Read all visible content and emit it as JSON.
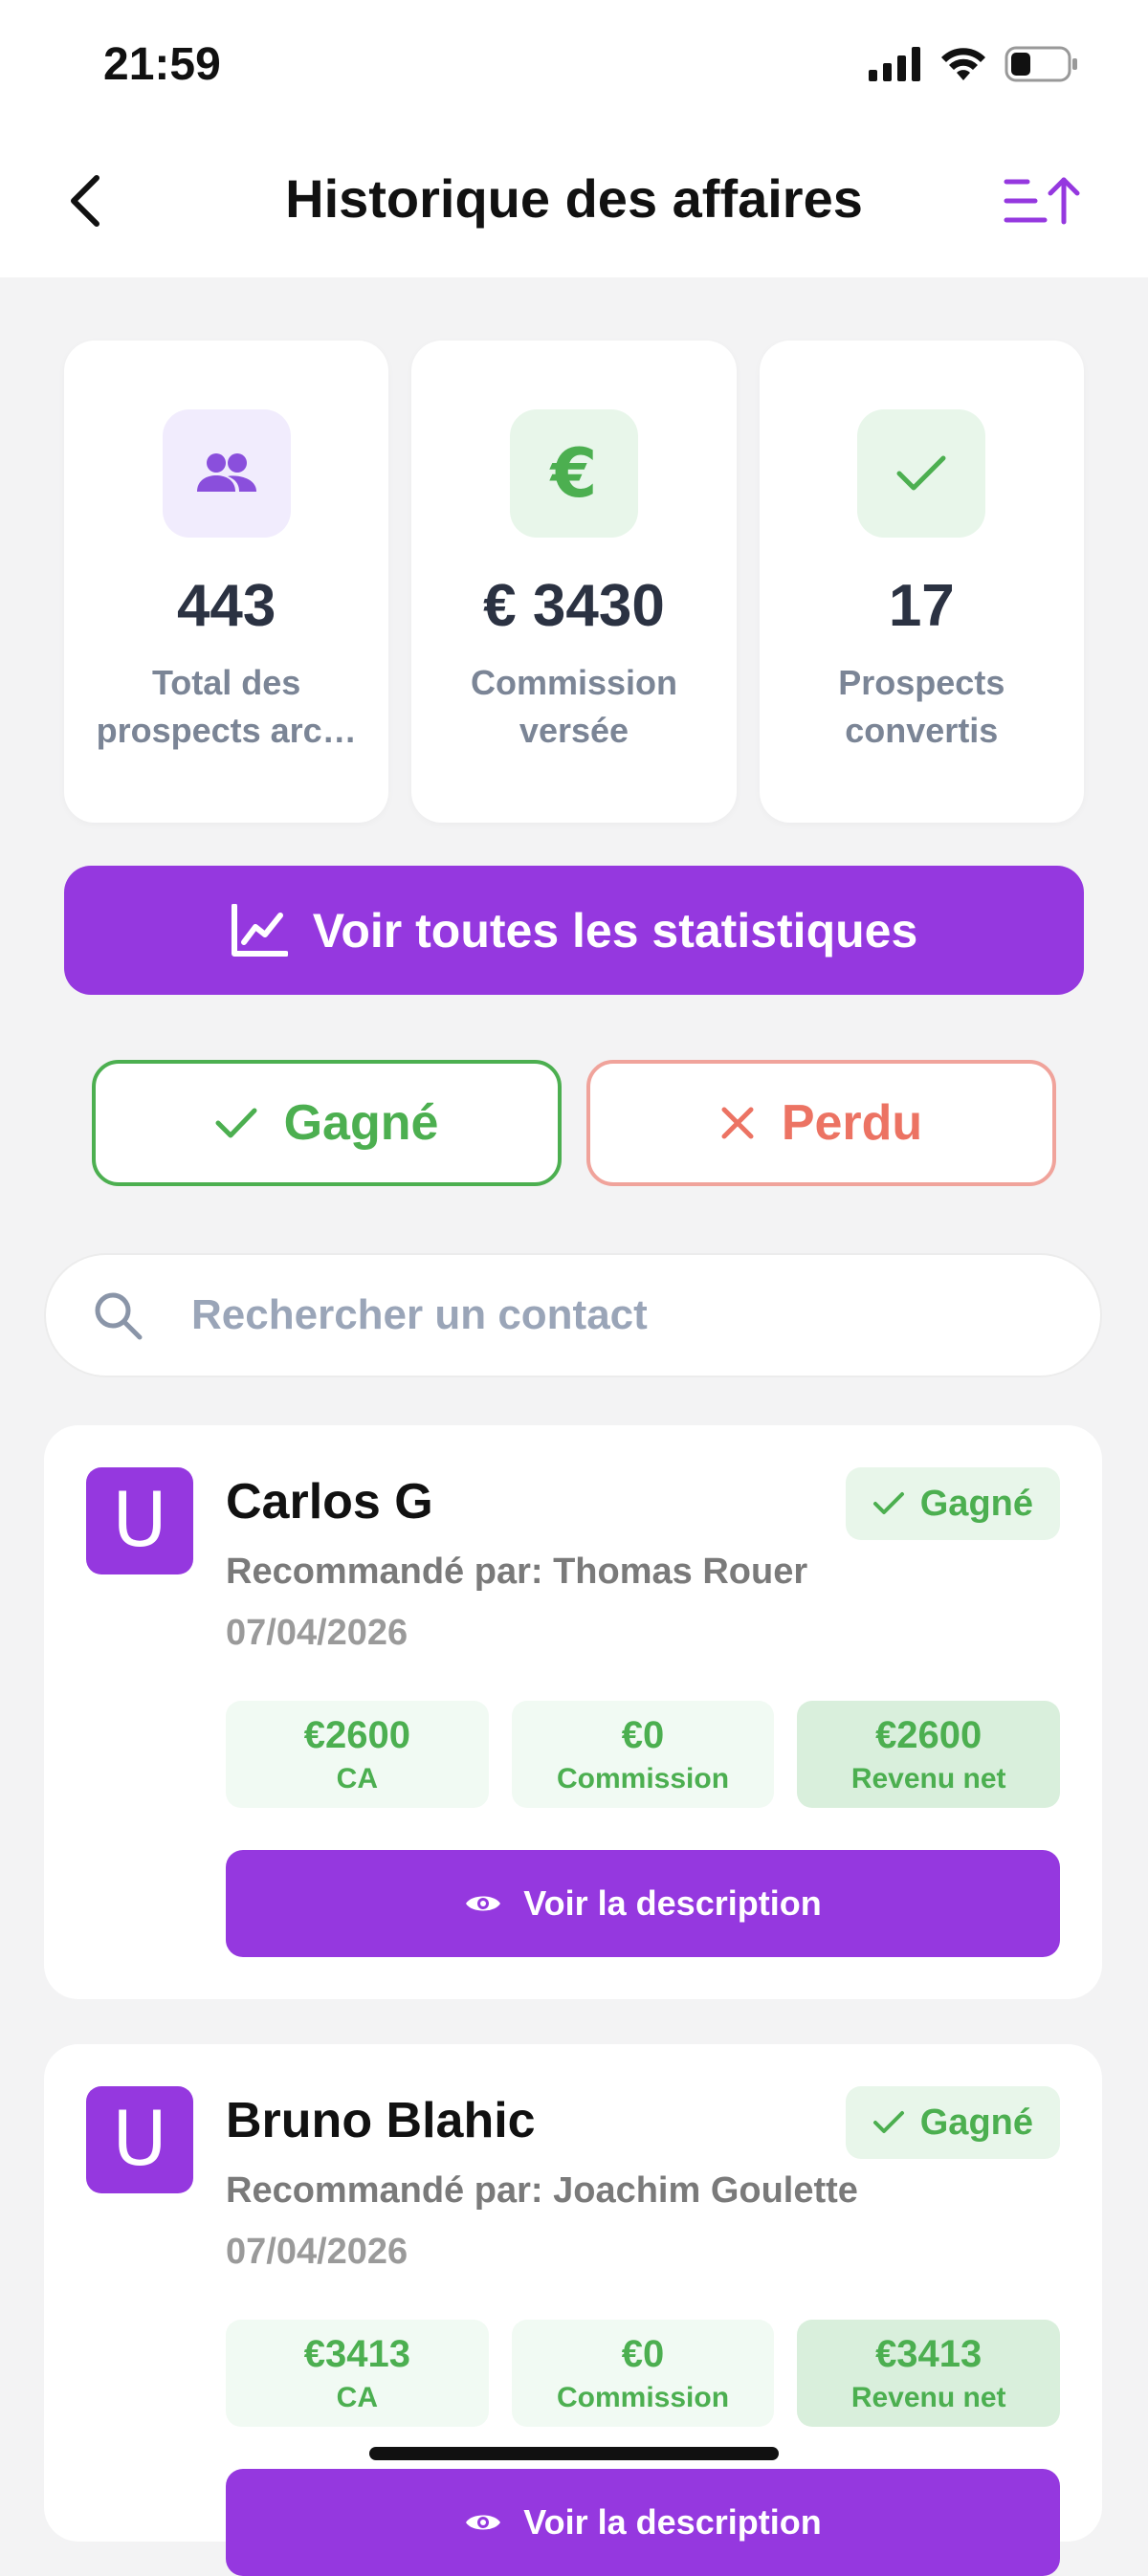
{
  "status_bar": {
    "time": "21:59"
  },
  "header": {
    "title": "Historique des affaires"
  },
  "stats": [
    {
      "icon": "people-icon",
      "value": "443",
      "label_line1": "Total des",
      "label_line2": "prospects arc…"
    },
    {
      "icon": "euro-icon",
      "value": "€ 3430",
      "label_line1": "Commission",
      "label_line2": "versée"
    },
    {
      "icon": "check-icon",
      "value": "17",
      "label_line1": "Prospects",
      "label_line2": "convertis"
    }
  ],
  "stats_button": {
    "label": "Voir toutes les statistiques"
  },
  "filters": {
    "won_label": "Gagné",
    "lost_label": "Perdu"
  },
  "search": {
    "placeholder": "Rechercher un contact",
    "value": ""
  },
  "deals": [
    {
      "avatar_letter": "U",
      "name": "Carlos G",
      "status": "Gagné",
      "referrer": "Recommandé par: Thomas Rouer",
      "date": "07/04/2026",
      "ca_value": "€2600",
      "ca_label": "CA",
      "commission_value": "€0",
      "commission_label": "Commission",
      "net_value": "€2600",
      "net_label": "Revenu net",
      "button_label": "Voir la description"
    },
    {
      "avatar_letter": "U",
      "name": "Bruno Blahic",
      "status": "Gagné",
      "referrer": "Recommandé par: Joachim Goulette",
      "date": "07/04/2026",
      "ca_value": "€3413",
      "ca_label": "CA",
      "commission_value": "€0",
      "commission_label": "Commission",
      "net_value": "€3413",
      "net_label": "Revenu net",
      "button_label": "Voir la description"
    }
  ],
  "colors": {
    "primary": "#9538df",
    "success": "#4caf50",
    "danger": "#ec7363",
    "muted_text": "#7b8596"
  }
}
